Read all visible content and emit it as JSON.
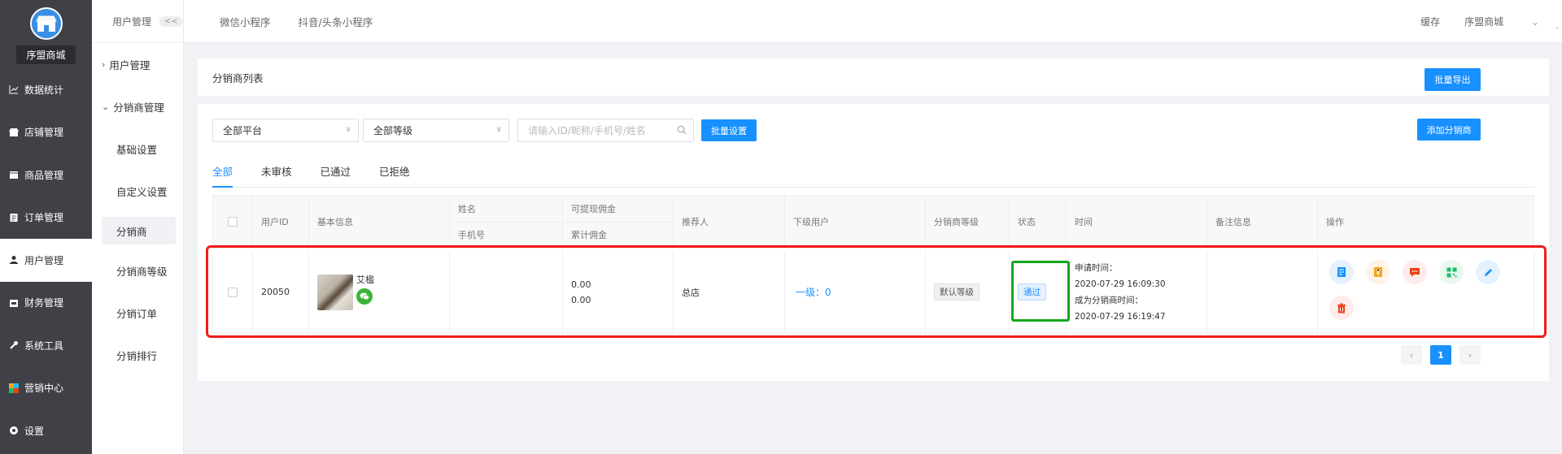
{
  "sidebar": {
    "shop_name": "序盟商城",
    "items": [
      {
        "label": "数据统计",
        "icon": "chart-icon"
      },
      {
        "label": "店铺管理",
        "icon": "store-icon"
      },
      {
        "label": "商品管理",
        "icon": "box-icon"
      },
      {
        "label": "订单管理",
        "icon": "order-icon"
      },
      {
        "label": "用户管理",
        "icon": "user-icon"
      },
      {
        "label": "财务管理",
        "icon": "wallet-icon"
      },
      {
        "label": "系统工具",
        "icon": "wrench-icon"
      },
      {
        "label": "营销中心",
        "icon": "marketing-icon"
      },
      {
        "label": "设置",
        "icon": "settings-icon"
      }
    ]
  },
  "subsidebar": {
    "header": "用户管理",
    "collapse": "<<",
    "groups": [
      {
        "label": "用户管理"
      },
      {
        "label": "分销商管理"
      }
    ],
    "leaves": [
      "基础设置",
      "自定义设置",
      "分销商",
      "分销商等级",
      "分销订单",
      "分销排行"
    ]
  },
  "topbar": {
    "tabs": [
      "微信小程序",
      "抖音/头条小程序"
    ],
    "cache": "缓存",
    "user": "序盟商城",
    "user_arrow": "⌄"
  },
  "page": {
    "title": "分销商列表",
    "export_btn": "批量导出"
  },
  "filters": {
    "platform": "全部平台",
    "level": "全部等级",
    "search_placeholder": "请输入ID/昵称/手机号/姓名",
    "batch_btn": "批量设置",
    "add_btn": "添加分销商"
  },
  "tabs": [
    "全部",
    "未审核",
    "已通过",
    "已拒绝"
  ],
  "table": {
    "headers": {
      "user_id": "用户ID",
      "basic": "基本信息",
      "name": "姓名",
      "phone": "手机号",
      "withdrawable": "可提现佣金",
      "total": "累计佣金",
      "referrer": "推荐人",
      "downline": "下级用户",
      "level": "分销商等级",
      "status": "状态",
      "time": "时间",
      "remark": "备注信息",
      "ops": "操作"
    },
    "rows": [
      {
        "user_id": "20050",
        "nickname": "艾楹",
        "withdrawable": "0.00",
        "total": "0.00",
        "referrer": "总店",
        "downline": "一级：0",
        "level": "默认等级",
        "status": "通过",
        "apply_label": "申请时间：",
        "apply_time": "2020-07-29 16:09:30",
        "become_label": "成为分销商时间：",
        "become_time": "2020-07-29 16:19:47"
      }
    ]
  },
  "pagination": {
    "prev": "‹",
    "current": "1",
    "next": "›"
  },
  "colors": {
    "primary": "#1890ff",
    "sidebar_bg": "#3f4146",
    "highlight_red": "#f21a1a",
    "highlight_green": "#15a51d"
  }
}
